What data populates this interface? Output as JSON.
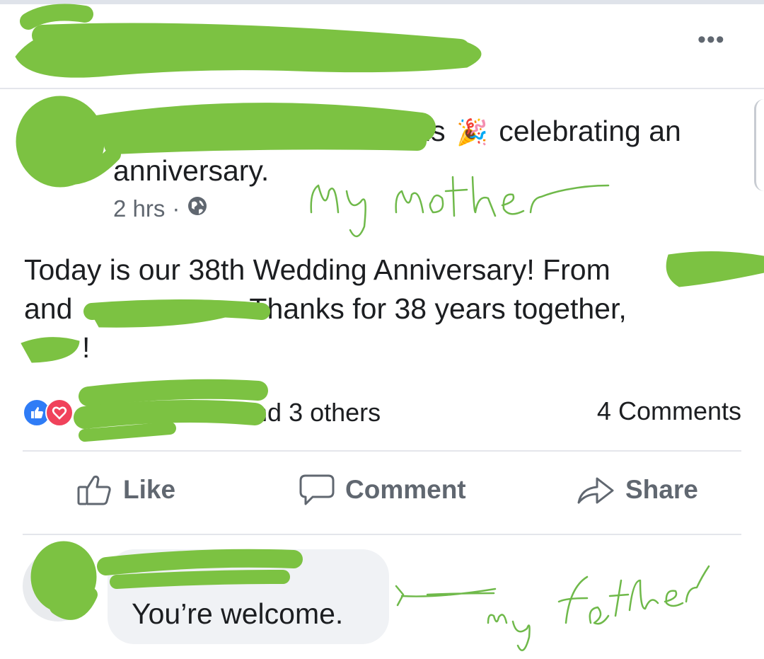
{
  "post": {
    "headline_is": "is",
    "headline_rest": "celebrating an anniversary.",
    "party_emoji": "🎉",
    "time": "2 hrs",
    "separator": "·",
    "visibility_icon": "globe-icon",
    "text_line1": "Today is our 38th Wedding Anniversary! From",
    "text_and": "and",
    "text_thanks": "Thanks for 38 years together,",
    "text_end": "!",
    "reactions": {
      "icons": [
        "like-reaction-icon",
        "love-reaction-icon"
      ],
      "others": "and 3 others"
    },
    "comments_count": "4 Comments"
  },
  "actions": {
    "like": "Like",
    "comment": "Comment",
    "share": "Share"
  },
  "comment": {
    "text": "You’re welcome."
  },
  "annotations": {
    "mother": "My mother",
    "father": "my father"
  },
  "colors": {
    "redaction": "#7cc242",
    "handwriting": "#6fb94a",
    "like_blue": "#2f7cf6",
    "love_red": "#f0425b",
    "bubble": "#f0f2f5"
  }
}
